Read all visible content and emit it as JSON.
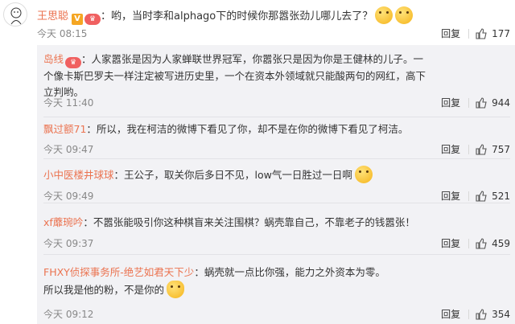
{
  "main": {
    "author": "王思聪",
    "verify_badge": "V",
    "rank_badge": "♛",
    "text": "：哟，当时李和alphago下的时候你那嚣张劲儿哪儿去了？",
    "time": "今天 08:15",
    "reply_label": "回复",
    "likes": "177",
    "emoji_icons": [
      "pensive-face-icon",
      "pensive-face-icon"
    ]
  },
  "replies": [
    {
      "author": "岛线",
      "text": "：人家嚣张是因为人家蝉联世界冠军，你嚣张只是因为你是王健林的儿子。一个像卡斯巴罗夫一样注定被写进历史里，一个在资本外领域就只能酸两句的网红，高下立判哟。",
      "time": "今天 11:40",
      "reply_label": "回复",
      "likes": "944",
      "has_vip": true
    },
    {
      "author": "飘过额71",
      "text": "：所以，我在柯洁的微博下看见了你，却不是在你的微博下看见了柯洁。",
      "time": "今天 09:47",
      "reply_label": "回复",
      "likes": "757"
    },
    {
      "author": "小中医楼井球球",
      "text": "：王公子，取关你后多日不见，low气一日胜过一日啊",
      "time": "今天 09:49",
      "reply_label": "回复",
      "likes": "521",
      "emoji_icon": "grinning-face-icon"
    },
    {
      "author": "xf蘼琬吟",
      "text": "：不嚣张能吸引你这种棋盲来关注围棋？蜗壳靠自己，不靠老子的钱嚣张！",
      "time": "今天 09:37",
      "reply_label": "回复",
      "likes": "459"
    },
    {
      "author": "FHXY侦探事务所-绝艺如君天下少",
      "text": "：蜗壳就一点比你强，能力之外资本为零。所以我是他的粉，不是你的",
      "time": "今天 09:12",
      "reply_label": "回复",
      "likes": "354",
      "emoji_icon": "doge-cat-icon"
    }
  ]
}
